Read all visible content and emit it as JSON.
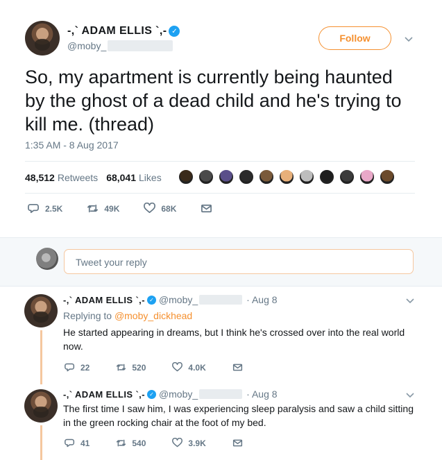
{
  "main_tweet": {
    "display_name": "-,` ADAM ELLIS `,-",
    "handle": "@moby_",
    "follow_label": "Follow",
    "text": "So, my apartment is currently being haunted by the ghost of a dead child and he's trying to kill me. (thread)",
    "timestamp": "1:35 AM - 8 Aug 2017",
    "retweets_count": "48,512",
    "retweets_label": "Retweets",
    "likes_count": "68,041",
    "likes_label": "Likes",
    "reply_count": "2.5K",
    "retweet_action_count": "49K",
    "like_action_count": "68K",
    "likers": [
      "#3a2a1a",
      "#4a4a4a",
      "#5a4f8a",
      "#2b2b2b",
      "#7a5a3a",
      "#e8b07a",
      "#bdbdbd",
      "#1e1e1e",
      "#3b3b3b",
      "#e9a8c8",
      "#6b4a2b"
    ]
  },
  "reply_bar": {
    "placeholder": "Tweet your reply"
  },
  "thread": [
    {
      "display_name": "-,` ADAM ELLIS `,-",
      "handle": "@moby_",
      "date": "· Aug 8",
      "replying_to_label": "Replying to",
      "replying_to_handle": "@moby_dickhead",
      "text": "He started appearing in dreams, but I think he's crossed over into the real world now.",
      "reply_count": "22",
      "retweet_count": "520",
      "like_count": "4.0K"
    },
    {
      "display_name": "-,` ADAM ELLIS `,-",
      "handle": "@moby_",
      "date": "· Aug 8",
      "text": "The first time I saw him, I was experiencing sleep paralysis and saw a child sitting in the green rocking chair at the foot of my bed.",
      "reply_count": "41",
      "retweet_count": "540",
      "like_count": "3.9K"
    }
  ],
  "colors": {
    "accent": "#f5902f",
    "verified": "#1da1f2",
    "muted": "#657786",
    "thread_line": "#f5c79f"
  }
}
